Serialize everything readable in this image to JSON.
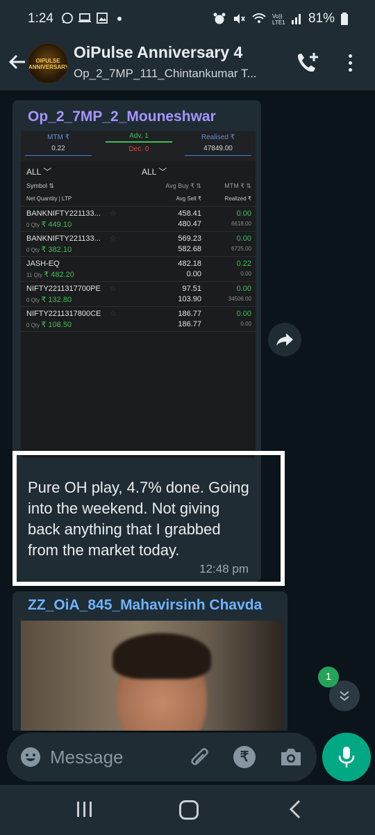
{
  "status_bar": {
    "time": "1:24",
    "battery": "81%"
  },
  "header": {
    "avatar_text": "OIPULSE ANNIVERSARY",
    "title": "OiPulse Anniversary 4",
    "subtitle": "Op_2_7MP_111_Chintankumar T..."
  },
  "message1": {
    "sender": "Op_2_7MP_2_Mouneshwar",
    "text": "Pure OH play, 4.7% done. Going into the weekend. Not giving back anything that I grabbed from the market today.",
    "time": "12:48 pm"
  },
  "screenshot": {
    "mtm_label": "MTM ₹",
    "mtm_value": "0.22",
    "adv": "Adv. 1",
    "dec": "Dec. 0",
    "realised_label": "Realised ₹",
    "realised_value": "47849.00",
    "filter1": "ALL ﹀",
    "filter2": "ALL ﹀",
    "col_symbol": "Symbol ⇅",
    "col_avg_buy": "Avg Buy ₹ ⇅",
    "col_mtm": "MTM ₹ ⇅",
    "col_net_qty": "Net Quantity | LTP",
    "col_avg_sell": "Avg Sell ₹",
    "col_realized": "Realized ₹",
    "rows": [
      {
        "symbol": "BANKNIFTY221133...",
        "qty": "0 Qty",
        "ltp": "₹ 449.10",
        "avg_buy": "458.41",
        "avg_sell": "480.47",
        "mtm": "0.00",
        "realized": "6618.00"
      },
      {
        "symbol": "BANKNIFTY221133...",
        "qty": "0 Qty",
        "ltp": "₹ 382.10",
        "avg_buy": "569.23",
        "avg_sell": "582.68",
        "mtm": "0.00",
        "realized": "6725.00"
      },
      {
        "symbol": "JASH-EQ",
        "qty": "11 Qty",
        "ltp": "₹ 482.20",
        "avg_buy": "482.18",
        "avg_sell": "0.00",
        "mtm": "0.22",
        "realized": "0.00"
      },
      {
        "symbol": "NIFTY2211317700PE",
        "qty": "0 Qty",
        "ltp": "₹ 132.80",
        "avg_buy": "97.51",
        "avg_sell": "103.90",
        "mtm": "0.00",
        "realized": "34506.00"
      },
      {
        "symbol": "NIFTY2211317800CE",
        "qty": "0 Qty",
        "ltp": "₹ 108.50",
        "avg_buy": "186.77",
        "avg_sell": "186.77",
        "mtm": "0.00",
        "realized": "0.00"
      }
    ]
  },
  "message2": {
    "sender": "ZZ_OiA_845_Mahavirsinh Chavda"
  },
  "unread_count": "1",
  "input": {
    "placeholder": "Message",
    "rupee_symbol": "₹"
  },
  "colors": {
    "accent_green": "#00a884",
    "sender1_color": "#a694ff",
    "sender2_color": "#6fb3ff"
  }
}
